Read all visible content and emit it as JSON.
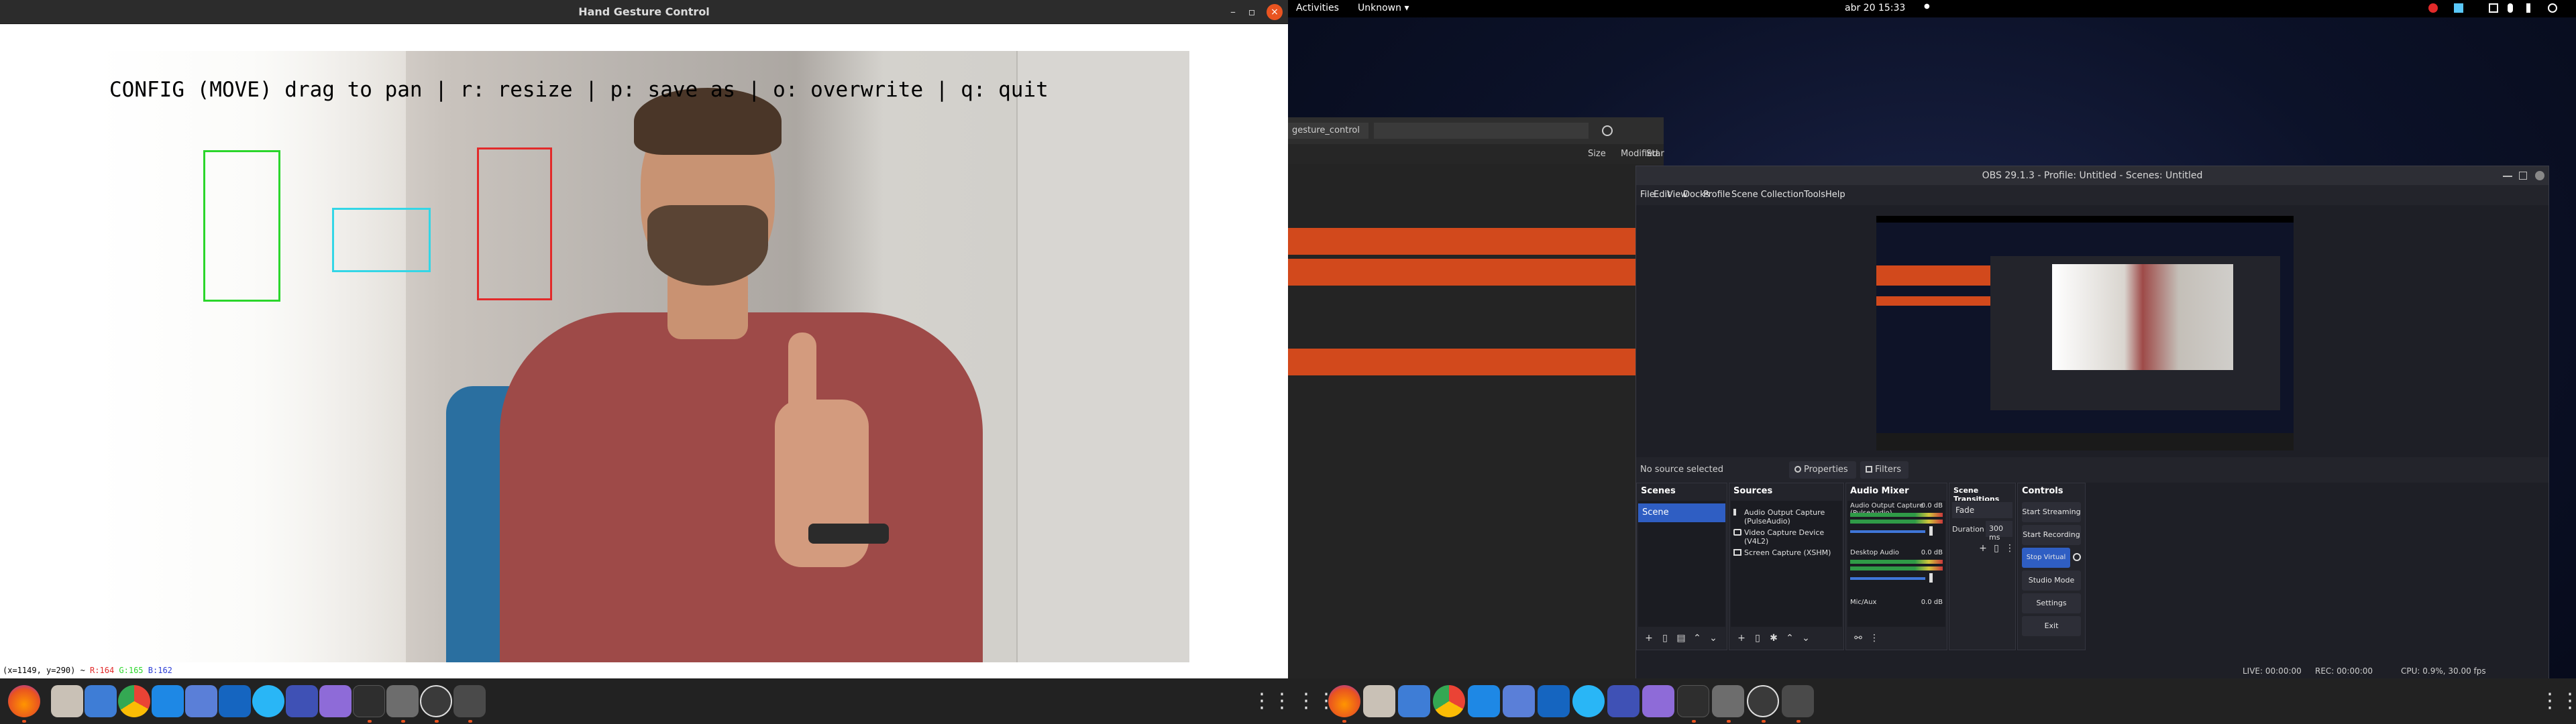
{
  "left": {
    "window_title": "Hand Gesture Control",
    "window_controls": {
      "minimize": "–",
      "maximize": "▫",
      "close": "×"
    },
    "overlay_text": "CONFIG (MOVE) drag to pan | r: resize | p: save as | o: overwrite | q: quit",
    "status_prefix": "(x=1149, y=290) ~ ",
    "status_r": "R:164",
    "status_g": "G:165",
    "status_b": "B:162",
    "box_colors": {
      "green": "#2bd62b",
      "cyan": "#33d6e6",
      "red": "#e22a2a"
    }
  },
  "taskbar": {
    "apps_glyph": "⋮⋮⋮",
    "accent": "#e95420"
  },
  "right": {
    "topbar": {
      "activities": "Activities",
      "app_menu": "Unknown ▾",
      "clock": "abr 20  15:33",
      "record_dot": "●"
    },
    "files": {
      "path": "gesture_control",
      "columns": {
        "size": "Size",
        "modified": "Modified",
        "star": "Star"
      }
    },
    "obs": {
      "title": "OBS 29.1.3 - Profile: Untitled - Scenes: Untitled",
      "menu": [
        "File",
        "Edit",
        "View",
        "Docks",
        "Profile",
        "Scene Collection",
        "Tools",
        "Help"
      ],
      "no_source": "No source selected",
      "properties": "Properties",
      "filters": "Filters",
      "scenes": {
        "title": "Scenes",
        "items": [
          "Scene"
        ]
      },
      "sources": {
        "title": "Sources",
        "items": [
          "Audio Output Capture (PulseAudio)",
          "Video Capture Device (V4L2)",
          "Screen Capture (XSHM)"
        ]
      },
      "audio_mixer": {
        "title": "Audio Mixer",
        "tracks": [
          {
            "name": "Audio Output Capture (PulseAudio)",
            "db": "0.0 dB"
          },
          {
            "name": "Desktop Audio",
            "db": "0.0 dB"
          },
          {
            "name": "Mic/Aux",
            "db": "0.0 dB"
          }
        ]
      },
      "transitions": {
        "title": "Scene Transitions",
        "type": "Fade",
        "duration_label": "Duration",
        "duration": "300 ms"
      },
      "controls": {
        "title": "Controls",
        "buttons": [
          "Start Streaming",
          "Start Recording",
          "Stop Virtual Camera",
          "Studio Mode",
          "Settings",
          "Exit"
        ]
      },
      "status": {
        "live": "LIVE: 00:00:00",
        "rec": "REC: 00:00:00",
        "cpu": "CPU: 0.9%, 30.00 fps"
      }
    }
  }
}
